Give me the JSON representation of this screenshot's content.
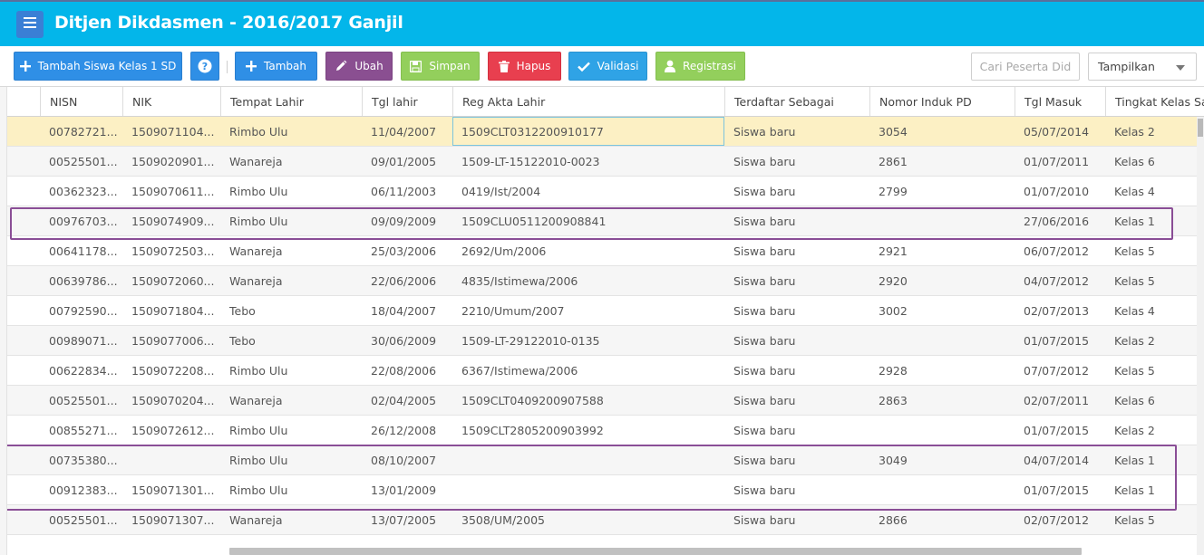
{
  "app": {
    "title": "Ditjen Dikdasmen - 2016/2017 Ganjil"
  },
  "toolbar": {
    "tambah_siswa_label": "Tambah Siswa Kelas 1 SD",
    "help_label": "?",
    "tambah_label": "Tambah",
    "ubah_label": "Ubah",
    "simpan_label": "Simpan",
    "hapus_label": "Hapus",
    "validasi_label": "Validasi",
    "registrasi_label": "Registrasi",
    "search_placeholder": "Cari Peserta Did",
    "display_select": "Tampilkan"
  },
  "colors": {
    "header": "#03b6ea",
    "selected_row": "#fcf0c4",
    "highlight_box": "#8a4e96"
  },
  "table": {
    "columns": [
      "NISN",
      "NIK",
      "Tempat Lahir",
      "Tgl lahir",
      "Reg Akta Lahir",
      "Terdaftar Sebagai",
      "Nomor Induk PD",
      "Tgl Masuk",
      "Tingkat Kelas Saa"
    ],
    "rows": [
      [
        "00782721...",
        "1509071104...",
        "Rimbo Ulu",
        "11/04/2007",
        "1509CLT0312200910177",
        "Siswa baru",
        "3054",
        "05/07/2014",
        "Kelas 2"
      ],
      [
        "00525501...",
        "1509020901...",
        "Wanareja",
        "09/01/2005",
        "1509-LT-15122010-0023",
        "Siswa baru",
        "2861",
        "01/07/2011",
        "Kelas 6"
      ],
      [
        "00362323...",
        "1509070611...",
        "Rimbo Ulu",
        "06/11/2003",
        "0419/Ist/2004",
        "Siswa baru",
        "2799",
        "01/07/2010",
        "Kelas 4"
      ],
      [
        "00976703...",
        "1509074909...",
        "Rimbo Ulu",
        "09/09/2009",
        "1509CLU0511200908841",
        "Siswa baru",
        "",
        "27/06/2016",
        "Kelas 1"
      ],
      [
        "00641178...",
        "1509072503...",
        "Wanareja",
        "25/03/2006",
        "2692/Um/2006",
        "Siswa baru",
        "2921",
        "06/07/2012",
        "Kelas 5"
      ],
      [
        "00639786...",
        "1509072060...",
        "Wanareja",
        "22/06/2006",
        "4835/Istimewa/2006",
        "Siswa baru",
        "2920",
        "04/07/2012",
        "Kelas 5"
      ],
      [
        "00792590...",
        "1509071804...",
        "Tebo",
        "18/04/2007",
        "2210/Umum/2007",
        "Siswa baru",
        "3002",
        "02/07/2013",
        "Kelas 4"
      ],
      [
        "00989071...",
        "1509077006...",
        "Tebo",
        "30/06/2009",
        "1509-LT-29122010-0135",
        "Siswa baru",
        "",
        "01/07/2015",
        "Kelas 2"
      ],
      [
        "00622834...",
        "1509072208...",
        "Rimbo Ulu",
        "22/08/2006",
        "6367/Istimewa/2006",
        "Siswa baru",
        "2928",
        "07/07/2012",
        "Kelas 5"
      ],
      [
        "00525501...",
        "1509070204...",
        "Wanareja",
        "02/04/2005",
        "1509CLT0409200907588",
        "Siswa baru",
        "2863",
        "02/07/2011",
        "Kelas 6"
      ],
      [
        "00855271...",
        "1509072612...",
        "Rimbo Ulu",
        "26/12/2008",
        "1509CLT2805200903992",
        "Siswa baru",
        "",
        "01/07/2015",
        "Kelas 2"
      ],
      [
        "00735380...",
        "",
        "Rimbo Ulu",
        "08/10/2007",
        "",
        "Siswa baru",
        "3049",
        "04/07/2014",
        "Kelas 1"
      ],
      [
        "00912383...",
        "1509071301...",
        "Rimbo Ulu",
        "13/01/2009",
        "",
        "Siswa baru",
        "",
        "01/07/2015",
        "Kelas 1"
      ],
      [
        "00525501...",
        "1509071307...",
        "Wanareja",
        "13/07/2005",
        "3508/UM/2005",
        "Siswa baru",
        "2866",
        "02/07/2012",
        "Kelas 5"
      ]
    ]
  }
}
